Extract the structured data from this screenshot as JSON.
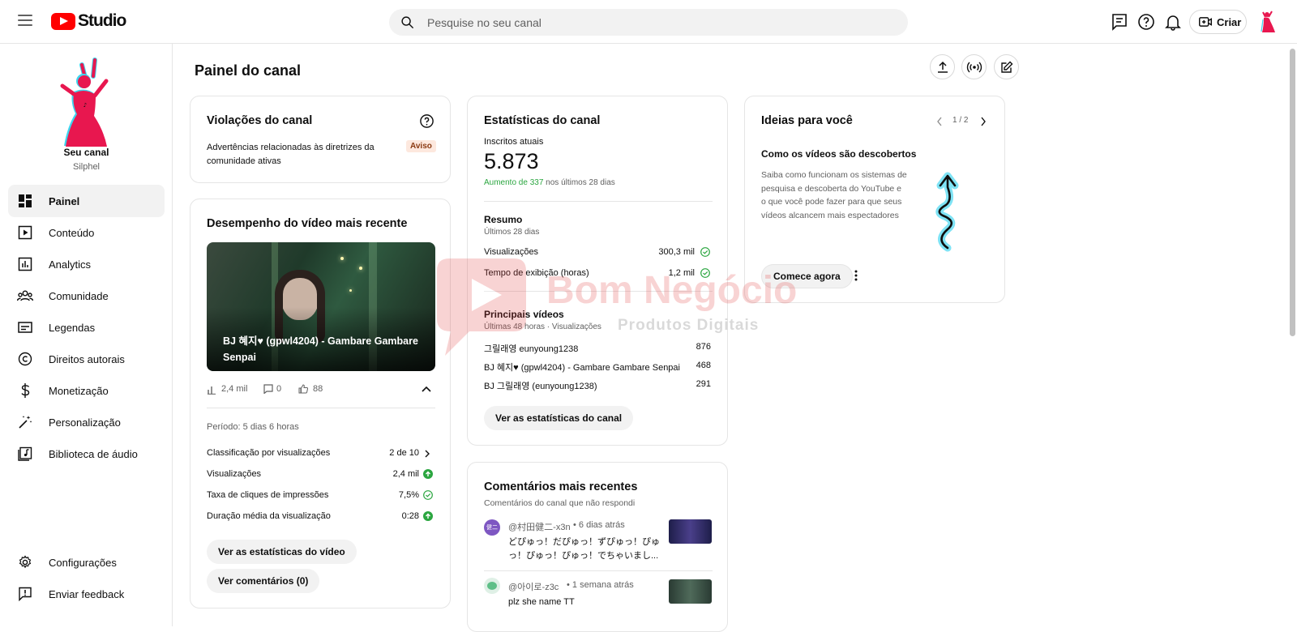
{
  "app": {
    "logo_text": "Studio"
  },
  "search": {
    "placeholder": "Pesquise no seu canal"
  },
  "header": {
    "create_label": "Criar"
  },
  "sidebar": {
    "channel_label": "Seu canal",
    "channel_handle": "Silphel",
    "items": [
      {
        "label": "Painel",
        "icon": "dashboard-icon"
      },
      {
        "label": "Conteúdo",
        "icon": "content-icon"
      },
      {
        "label": "Analytics",
        "icon": "analytics-icon"
      },
      {
        "label": "Comunidade",
        "icon": "community-icon"
      },
      {
        "label": "Legendas",
        "icon": "subtitles-icon"
      },
      {
        "label": "Direitos autorais",
        "icon": "copyright-icon"
      },
      {
        "label": "Monetização",
        "icon": "dollar-icon"
      },
      {
        "label": "Personalização",
        "icon": "magic-wand-icon"
      },
      {
        "label": "Biblioteca de áudio",
        "icon": "audio-library-icon"
      }
    ],
    "bottom": [
      {
        "label": "Configurações",
        "icon": "gear-icon"
      },
      {
        "label": "Enviar feedback",
        "icon": "feedback-icon"
      }
    ]
  },
  "main": {
    "title": "Painel do canal"
  },
  "violations": {
    "title": "Violações do canal",
    "text": "Advertências relacionadas às diretrizes da comunidade ativas",
    "badge": "Aviso"
  },
  "latest_video": {
    "title": "Desempenho do vídeo mais recente",
    "video_title": "BJ 혜지♥ (gpwl4204) - Gambare Gambare Senpai",
    "views_short": "2,4 mil",
    "comments": "0",
    "likes": "88",
    "period": "Período: 5 dias 6 horas",
    "rows": [
      {
        "label": "Classificação por visualizações",
        "value": "2 de 10"
      },
      {
        "label": "Visualizações",
        "value": "2,4 mil"
      },
      {
        "label": "Taxa de cliques de impressões",
        "value": "7,5%"
      },
      {
        "label": "Duração média da visualização",
        "value": "0:28"
      }
    ],
    "btn_stats": "Ver as estatísticas do vídeo",
    "btn_comments": "Ver comentários (0)"
  },
  "stats": {
    "title": "Estatísticas do canal",
    "subs_label": "Inscritos atuais",
    "subs_value": "5.873",
    "increase": "Aumento de 337",
    "increase_suffix": "nos últimos 28 dias",
    "summary_title": "Resumo",
    "summary_sub": "Últimos 28 dias",
    "summary_rows": [
      {
        "label": "Visualizações",
        "value": "300,3 mil"
      },
      {
        "label": "Tempo de exibição (horas)",
        "value": "1,2 mil"
      }
    ],
    "top_title": "Principais vídeos",
    "top_sub": "Últimas 48 horas · Visualizações",
    "top_rows": [
      {
        "label": "그릴래영 eunyoung1238",
        "value": "876"
      },
      {
        "label": "BJ 혜지♥ (gpwl4204) - Gambare Gambare Senpai",
        "value": "468"
      },
      {
        "label": "BJ 그릴래영 (eunyoung1238)",
        "value": "291"
      }
    ],
    "btn": "Ver as estatísticas do canal"
  },
  "comments": {
    "title": "Comentários mais recentes",
    "sub": "Comentários do canal que não respondi",
    "items": [
      {
        "author": "@村田健二-x3n",
        "time": "• 6 dias atrás",
        "text": "どぴゅっ！だぴゅっ！ずぴゅっ！ぴゅっ！ぴゅっ！ぴゅっ！でちゃいまし...",
        "avatar_text": "健二"
      },
      {
        "author": "@아이로-z3c",
        "time": "• 1 semana atrás",
        "text": "plz she name TT",
        "avatar_text": ""
      }
    ]
  },
  "ideas": {
    "title": "Ideias para você",
    "pager": "1 / 2",
    "subtitle": "Como os vídeos são descobertos",
    "text": "Saiba como funcionam os sistemas de pesquisa e descoberta do YouTube e o que você pode fazer para que seus vídeos alcancem mais espectadores",
    "btn": "Comece agora"
  },
  "watermark": {
    "line1": "Bom Negócio",
    "line2": "Produtos Digitais"
  },
  "colors": {
    "brand_red": "#ff0000",
    "green": "#2ba640",
    "accent_pink": "#e8174f",
    "accent_cyan": "#3dd6f0"
  }
}
